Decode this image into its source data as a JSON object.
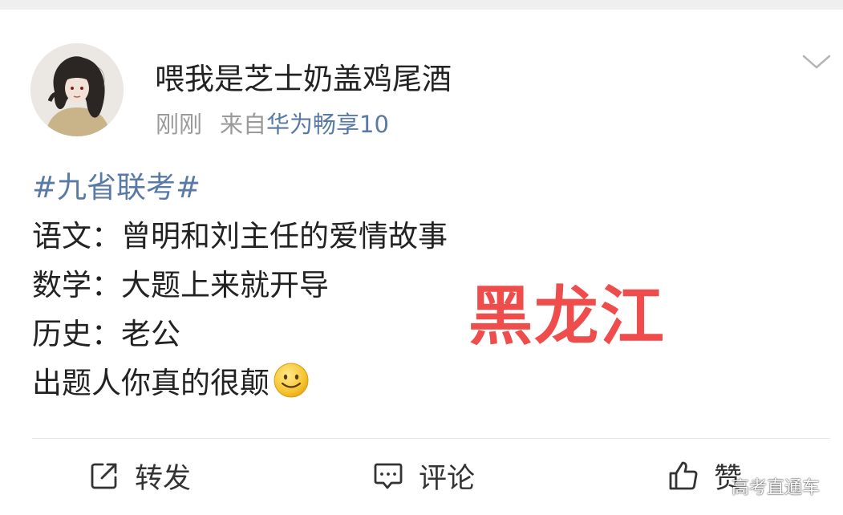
{
  "post": {
    "author": {
      "name": "喂我是芝士奶盖鸡尾酒",
      "avatar_icon": "avatar-illustration"
    },
    "time": "刚刚",
    "source_prefix": "来自",
    "source_device": "华为畅享10",
    "menu_icon": "chevron-down-icon",
    "content": {
      "hashtag": "#九省联考#",
      "lines": [
        "语文：曾明和刘主任的爱情故事",
        "数学：大题上来就开导",
        "历史：老公",
        "出题人你真的很颠"
      ],
      "emoji": "smile-emoji"
    },
    "overlay_text": "黑龙江",
    "overlay_color": "#ef4c4c",
    "link_color": "#5a7aa6"
  },
  "actions": {
    "repost": {
      "label": "转发",
      "icon": "repost-icon"
    },
    "comment": {
      "label": "评论",
      "icon": "comment-icon"
    },
    "like": {
      "label": "赞",
      "icon": "thumbs-up-icon"
    }
  },
  "watermark": "高考直通车"
}
